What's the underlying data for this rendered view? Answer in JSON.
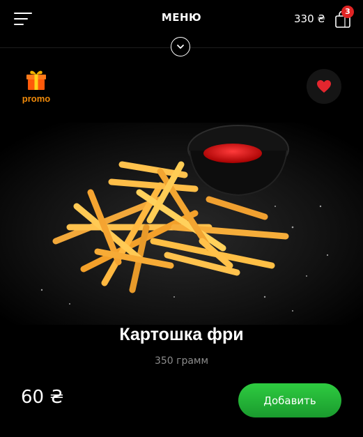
{
  "header": {
    "menu_icon": "hamburger-icon",
    "title": "МЕНЮ",
    "cart_total": "330 ₴",
    "cart_icon": "shopping-bag-icon",
    "cart_count": "3",
    "expand_icon": "chevron-down-icon"
  },
  "promo": {
    "icon": "gift-icon",
    "label": "promo"
  },
  "favorite": {
    "icon": "heart-icon",
    "color": "#e3262e"
  },
  "product": {
    "name": "Картошка фри",
    "weight": "350 грамм",
    "price": "60 ₴",
    "add_label": "Добавить"
  },
  "colors": {
    "background": "#000000",
    "accent_green": "#27c23a",
    "badge_red": "#e02424",
    "promo_orange": "#f08a0a"
  }
}
